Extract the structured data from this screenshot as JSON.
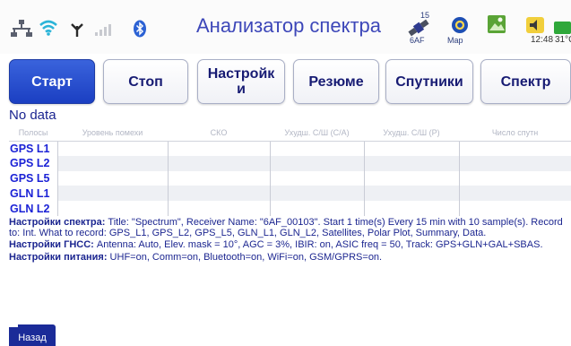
{
  "app": {
    "title": "Анализатор спектра"
  },
  "status_bar": {
    "satellite_count": "15",
    "satellite_label": "6AF",
    "map_label": "Map",
    "time": "12:48",
    "temperature": "31°C",
    "icons": [
      "network-icon",
      "wifi-icon",
      "antenna-icon",
      "signal-bars-icon",
      "bluetooth-icon",
      "satellite-icon",
      "map-icon",
      "photo-icon",
      "speaker-icon",
      "battery-icon"
    ]
  },
  "tabs": [
    {
      "label": "Старт",
      "active": true
    },
    {
      "label": "Стоп",
      "active": false
    },
    {
      "label": "Настройк\nи",
      "active": false
    },
    {
      "label": "Резюме",
      "active": false
    },
    {
      "label": "Спутники",
      "active": false
    },
    {
      "label": "Спектр",
      "active": false
    }
  ],
  "table": {
    "status": "No data",
    "headers": [
      "Полосы",
      "Уровень помехи",
      "СКО",
      "Ухудш. С/Ш (C/A)",
      "Ухудш. С/Ш (P)",
      "Число спутн"
    ],
    "rows": [
      "GPS L1",
      "GPS L2",
      "GPS L5",
      "GLN L1",
      "GLN L2"
    ]
  },
  "settings": {
    "spectrum_title": "Настройки спектра:",
    "spectrum_text": " Title: \"Spectrum\", Receiver Name: \"6AF_00103\". Start 1 time(s) Every 15 min with 10 sample(s). Record to: Int. What to record: GPS_L1, GPS_L2, GPS_L5, GLN_L1, GLN_L2, Satellites, Polar Plot, Summary, Data.",
    "gnss_title": "Настройки ГНСС:",
    "gnss_text": " Antenna: Auto, Elev. mask = 10°, AGC = 3%, IBIR: on, ASIC freq = 50, Track: GPS+GLN+GAL+SBAS.",
    "power_title": "Настройки питания:",
    "power_text": " UHF=on, Comm=on, Bluetooth=on, WiFi=on, GSM/GPRS=on."
  },
  "footer": {
    "back_label": "Назад"
  },
  "colors": {
    "accent": "#1b3fc2",
    "title": "#3d47b9",
    "row_label": "#1b22d6",
    "text": "#1c2690",
    "back_button": "#1b2b98"
  }
}
